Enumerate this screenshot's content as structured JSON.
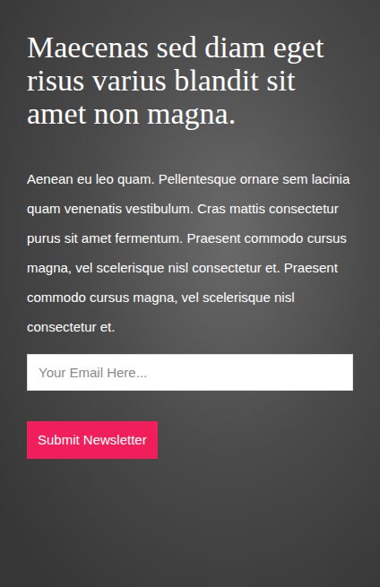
{
  "heading": "Maecenas sed diam eget risus varius blandit sit amet non magna.",
  "body": "Aenean eu leo quam. Pellentesque ornare sem lacinia quam venenatis vestibulum. Cras mattis consectetur purus sit amet fermentum. Praesent commodo cursus magna, vel scelerisque nisl consectetur et. Praesent commodo cursus magna, vel scelerisque nisl consectetur et.",
  "newsletter": {
    "placeholder": "Your Email Here...",
    "button": "Submit Newsletter"
  }
}
